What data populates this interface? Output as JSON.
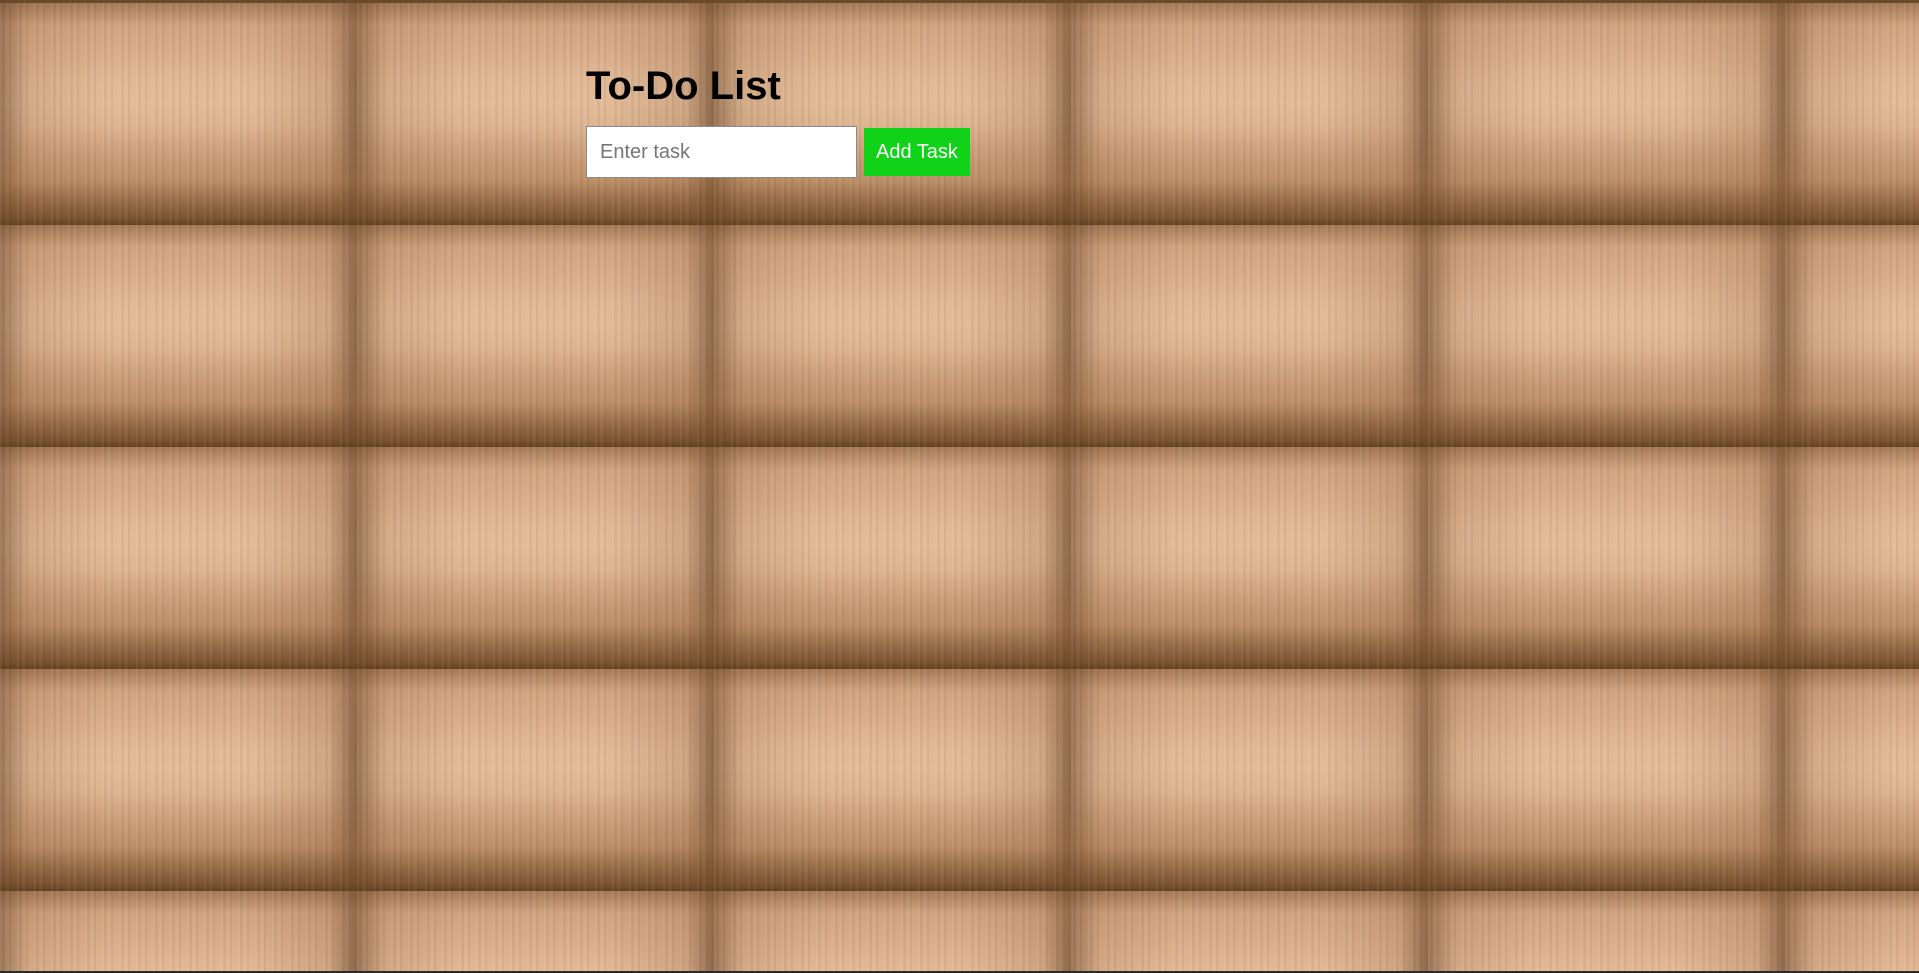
{
  "app": {
    "title": "To-Do List"
  },
  "form": {
    "input_value": "",
    "input_placeholder": "Enter task",
    "add_button_label": "Add Task"
  },
  "tasks": [],
  "colors": {
    "add_button_bg": "#0fd219",
    "add_button_text": "#ffffff",
    "title_text": "#000000",
    "input_bg": "#ffffff"
  }
}
